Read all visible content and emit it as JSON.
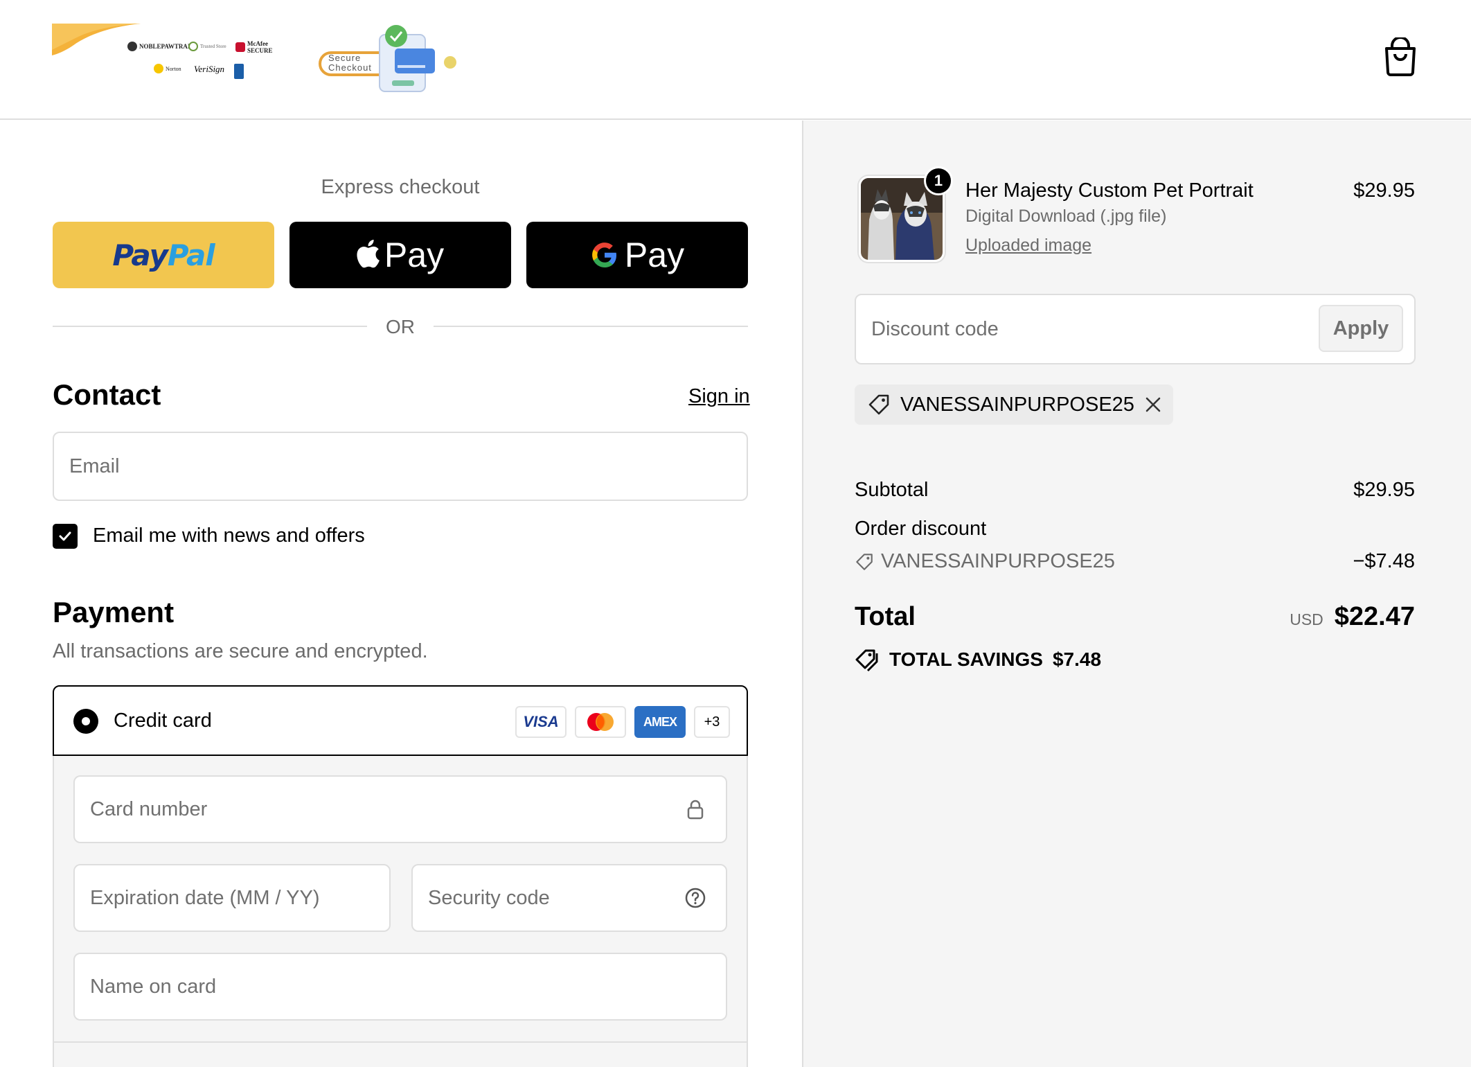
{
  "header": {
    "trust_badges": [
      "NOBLEPAWTRAIT",
      "Trusted Store",
      "McAfee SECURE",
      "Norton",
      "VeriSign"
    ],
    "secure_badge_line1": "Secure",
    "secure_badge_line2": "Checkout"
  },
  "express": {
    "title": "Express checkout",
    "paypal_part1": "Pay",
    "paypal_part2": "Pal",
    "apple_pay_label": "Pay",
    "google_pay_label": "Pay",
    "or_label": "OR"
  },
  "contact": {
    "heading": "Contact",
    "sign_in": "Sign in",
    "email_placeholder": "Email",
    "newsletter_label": "Email me with news and offers",
    "newsletter_checked": true
  },
  "payment": {
    "heading": "Payment",
    "subtext": "All transactions are secure and encrypted.",
    "method_label": "Credit card",
    "card_logos": [
      "VISA",
      "Mastercard",
      "AMEX"
    ],
    "more_cards": "+3",
    "card_number_placeholder": "Card number",
    "expiry_placeholder": "Expiration date (MM / YY)",
    "security_placeholder": "Security code",
    "name_placeholder": "Name on card"
  },
  "summary": {
    "product": {
      "quantity": "1",
      "title": "Her Majesty Custom Pet Portrait",
      "variant": "Digital Download (.jpg file)",
      "link": "Uploaded image",
      "price": "$29.95"
    },
    "discount_placeholder": "Discount code",
    "apply_label": "Apply",
    "applied_code": "VANESSAINPURPOSE25",
    "subtotal_label": "Subtotal",
    "subtotal_value": "$29.95",
    "order_discount_label": "Order discount",
    "order_discount_code": "VANESSAINPURPOSE25",
    "order_discount_value": "−$7.48",
    "total_label": "Total",
    "total_currency": "USD",
    "total_value": "$22.47",
    "savings_label": "TOTAL SAVINGS",
    "savings_value": "$7.48"
  },
  "colors": {
    "paypal_bg": "#f2c64f",
    "wallet_dark": "#000000",
    "summary_bg": "#f5f5f5",
    "amex_blue": "#2b6fc4"
  },
  "icons": [
    "shopping-bag-icon",
    "apple-icon",
    "google-g-icon",
    "check-icon",
    "lock-icon",
    "help-circle-icon",
    "tag-icon",
    "close-icon",
    "tags-icon"
  ]
}
